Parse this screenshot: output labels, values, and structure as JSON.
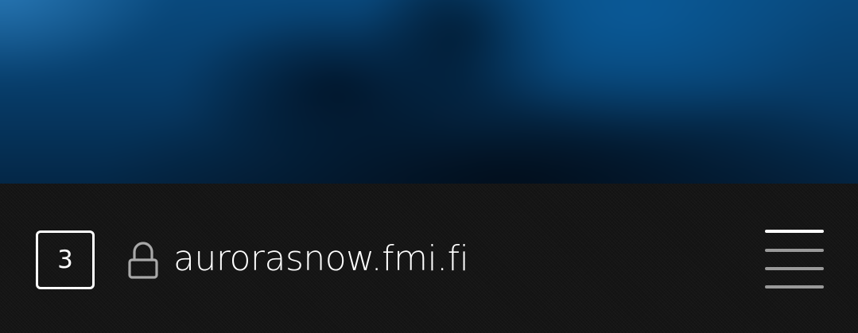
{
  "browser": {
    "tab_count": "3",
    "url": "aurorasnow.fmi.fi",
    "lock_icon": "lock-icon",
    "menu_icon": "hamburger-menu-icon"
  },
  "colors": {
    "toolbar_background": "#151515",
    "foreground": "#ffffff",
    "muted": "#9a9a9a",
    "hero_blue": "#0a4f86"
  }
}
